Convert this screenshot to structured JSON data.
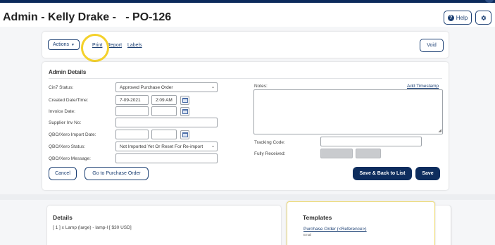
{
  "header": {
    "title": "Admin - Kelly Drake -   - PO-126",
    "help_label": "Help",
    "help_glyph": "?"
  },
  "actions_bar": {
    "actions_label": "Actions",
    "links": [
      "Print",
      "Report",
      "Labels"
    ],
    "void_label": "Void"
  },
  "admin": {
    "title": "Admin Details",
    "labels": {
      "status": "Cin7 Status:",
      "created": "Created Date/Time:",
      "invoice_date": "Invoice Date:",
      "supplier_inv": "Supplier Inv No:",
      "qbo_import_date": "QBO/Xero Import Date:",
      "qbo_status": "QBO/Xero Status:",
      "qbo_message": "QBO/Xero Message:",
      "notes": "Notes:",
      "tracking": "Tracking Code:",
      "fully_received": "Fully Received:"
    },
    "values": {
      "status": "Approved Purchase Order",
      "created_date": "7-09-2021",
      "created_time": "2:09 AM",
      "qbo_status": "Not Imported Yet Or Reset For Re-import"
    },
    "add_timestamp": "Add Timestamp",
    "buttons": {
      "cancel": "Cancel",
      "go_to_po": "Go to Purchase Order",
      "save_back": "Save & Back to List",
      "save": "Save"
    }
  },
  "details": {
    "title": "Details",
    "line": "[ 1 ] x Lamp (large) - lamp-l [ $30 USD]"
  },
  "templates": {
    "title": "Templates",
    "link": "Purchase Order (<Reference>)",
    "subtext": "Email"
  },
  "colors": {
    "primary": "#0e2d5e",
    "highlight": "#f4d12b"
  },
  "icons": [
    "help-icon",
    "gear-icon",
    "caret-down-icon",
    "calendar-icon",
    "resize-grip-icon"
  ]
}
